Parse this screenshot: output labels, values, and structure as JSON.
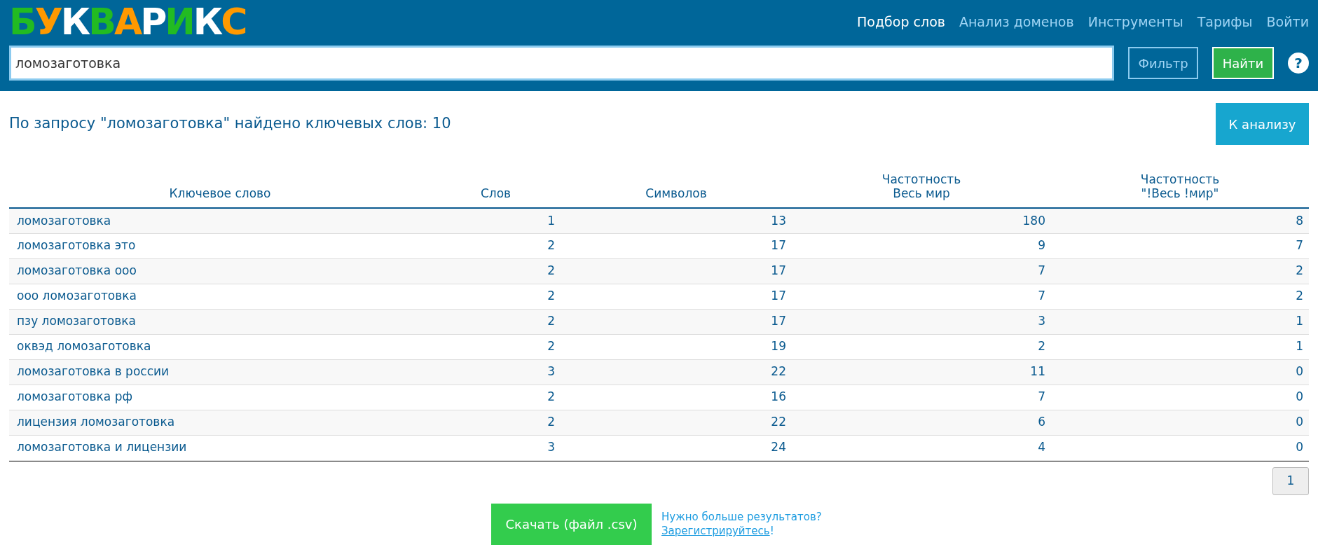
{
  "logo": {
    "letters": [
      {
        "char": "Б",
        "color": "#22bb22"
      },
      {
        "char": "У",
        "color": "#ff9900"
      },
      {
        "char": "К",
        "color": "#ffffff"
      },
      {
        "char": "В",
        "color": "#22bb22"
      },
      {
        "char": "А",
        "color": "#ff9900"
      },
      {
        "char": "Р",
        "color": "#ffffff"
      },
      {
        "char": "И",
        "color": "#22bb22"
      },
      {
        "char": "К",
        "color": "#ffffff"
      },
      {
        "char": "С",
        "color": "#ff9900"
      }
    ]
  },
  "nav": [
    {
      "label": "Подбор слов",
      "selected": true
    },
    {
      "label": "Анализ доменов",
      "selected": false
    },
    {
      "label": "Инструменты",
      "selected": false
    },
    {
      "label": "Тарифы",
      "selected": false
    },
    {
      "label": "Войти",
      "selected": false
    }
  ],
  "search": {
    "value": "ломозаготовка",
    "filter_button": "Фильтр",
    "submit_button": "Найти",
    "help": "?"
  },
  "result_heading": "По запросу \"ломозаготовка\" найдено ключевых слов: 10",
  "analyze_button": "К анализу",
  "table": {
    "columns": [
      "Ключевое слово",
      "Слов",
      "Символов",
      "Частотность\nВесь мир",
      "Частотность\n\"!Весь !мир\""
    ],
    "rows": [
      [
        "ломозаготовка",
        "1",
        "13",
        "180",
        "8"
      ],
      [
        "ломозаготовка это",
        "2",
        "17",
        "9",
        "7"
      ],
      [
        "ломозаготовка ооо",
        "2",
        "17",
        "7",
        "2"
      ],
      [
        "ооо ломозаготовка",
        "2",
        "17",
        "7",
        "2"
      ],
      [
        "пзу ломозаготовка",
        "2",
        "17",
        "3",
        "1"
      ],
      [
        "оквэд ломозаготовка",
        "2",
        "19",
        "2",
        "1"
      ],
      [
        "ломозаготовка в россии",
        "3",
        "22",
        "11",
        "0"
      ],
      [
        "ломозаготовка рф",
        "2",
        "16",
        "7",
        "0"
      ],
      [
        "лицензия ломозаготовка",
        "2",
        "22",
        "6",
        "0"
      ],
      [
        "ломозаготовка и лицензии",
        "3",
        "24",
        "4",
        "0"
      ]
    ]
  },
  "pagination": [
    {
      "label": "1",
      "selected": true
    }
  ],
  "download_button": "Скачать (файл .csv)",
  "more_results": {
    "question": "Нужно больше результатов?",
    "link": "Зарегистрируйтесь",
    "suffix": "!"
  }
}
